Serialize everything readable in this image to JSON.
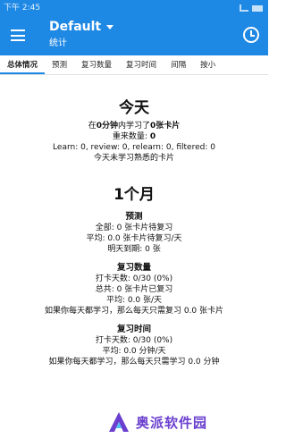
{
  "status_bar": {
    "time": "下午 2:45"
  },
  "appbar": {
    "title": "Default",
    "subtitle": "统计"
  },
  "tabs": [
    {
      "label": "总体情况",
      "active": true
    },
    {
      "label": "预测",
      "active": false
    },
    {
      "label": "复习数量",
      "active": false
    },
    {
      "label": "复习时间",
      "active": false
    },
    {
      "label": "间隔",
      "active": false
    },
    {
      "label": "按小",
      "active": false
    }
  ],
  "today": {
    "heading": "今天",
    "line1_pre": "在",
    "line1_time": "0分钟",
    "line1_mid": "内学习了",
    "line1_cards": "0张卡片",
    "relearn_label": "重来数量: ",
    "relearn_value": "0",
    "learn_line": "Learn: 0, review: 0, relearn: 0, filtered: 0",
    "note": "今天未学习熟悉的卡片"
  },
  "month": {
    "heading": "1个月",
    "forecast": {
      "title": "预测",
      "total": "全部: 0 张卡片待复习",
      "avg": "平均: 0.0 张卡片待复习/天",
      "tomorrow": "明天到期: 0 张"
    },
    "review_count": {
      "title": "复习数量",
      "days": "打卡天数: 0/30 (0%)",
      "total": "总共: 0 张卡片已复习",
      "avg": "平均: 0.0 张/天",
      "note": "如果你每天都学习，那么每天只需复习 0.0 张卡片"
    },
    "review_time": {
      "title": "复习时间",
      "days": "打卡天数: 0/30 (0%)",
      "avg": "平均: 0.0 分钟/天",
      "note": "如果你每天都学习，那么每天只需学习 0.0 分钟"
    }
  },
  "watermark": {
    "text": "奥派软件园"
  },
  "colors": {
    "primary": "#1e88e5",
    "watermark": "#6a3fcf"
  }
}
